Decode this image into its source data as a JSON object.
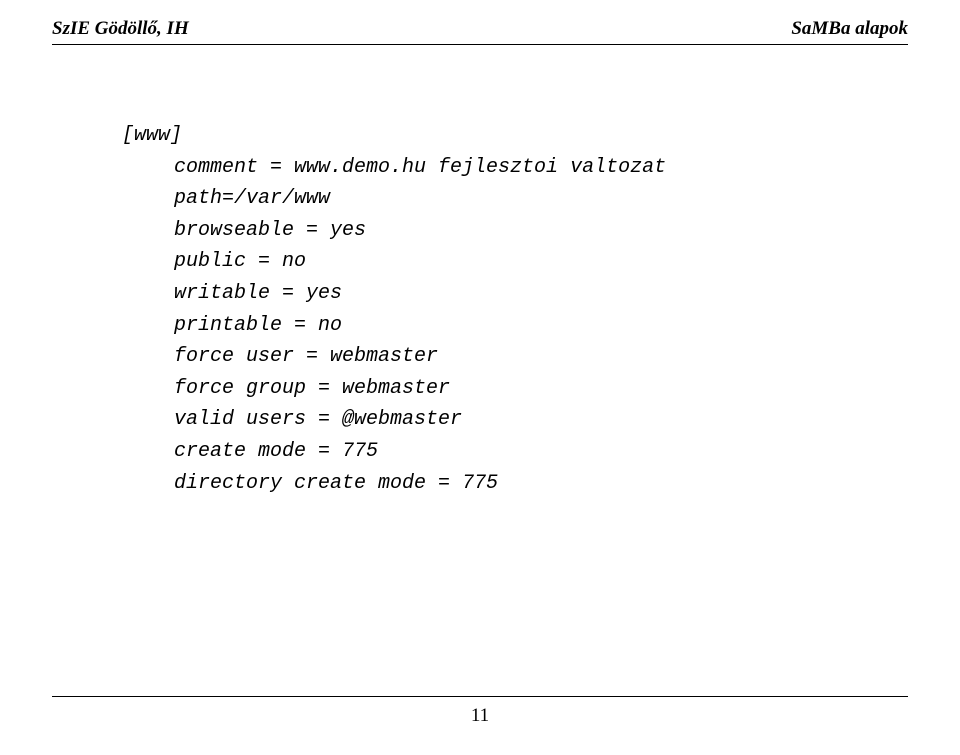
{
  "header": {
    "left": "SzIE Gödöllő, IH",
    "right": "SaMBa alapok"
  },
  "config": {
    "section": "[www]",
    "lines": [
      "comment = www.demo.hu fejlesztoi valtozat",
      "path=/var/www",
      "browseable = yes",
      "public = no",
      "writable = yes",
      "printable = no",
      "force user = webmaster",
      "force group = webmaster",
      "valid users = @webmaster",
      "create mode = 775",
      "directory create mode = 775"
    ]
  },
  "footer": {
    "page_number": "11"
  }
}
